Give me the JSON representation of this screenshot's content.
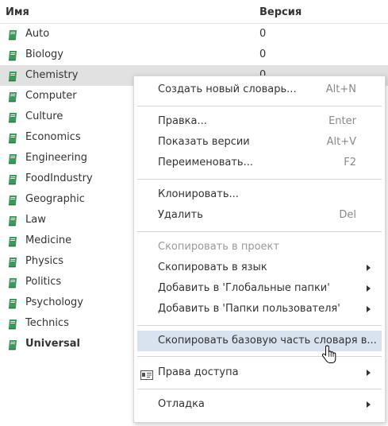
{
  "columns": {
    "name": "Имя",
    "version": "Версия"
  },
  "rows": [
    {
      "name": "Auto",
      "version": "0"
    },
    {
      "name": "Biology",
      "version": "0"
    },
    {
      "name": "Chemistry",
      "version": "0"
    },
    {
      "name": "Computer",
      "version": ""
    },
    {
      "name": "Culture",
      "version": ""
    },
    {
      "name": "Economics",
      "version": ""
    },
    {
      "name": "Engineering",
      "version": ""
    },
    {
      "name": "FoodIndustry",
      "version": ""
    },
    {
      "name": "Geographic",
      "version": ""
    },
    {
      "name": "Law",
      "version": ""
    },
    {
      "name": "Medicine",
      "version": ""
    },
    {
      "name": "Physics",
      "version": ""
    },
    {
      "name": "Politics",
      "version": ""
    },
    {
      "name": "Psychology",
      "version": ""
    },
    {
      "name": "Technics",
      "version": ""
    },
    {
      "name": "Universal",
      "version": ""
    }
  ],
  "menu": {
    "new_dictionary": {
      "label": "Создать новый словарь...",
      "shortcut": "Alt+N"
    },
    "edit": {
      "label": "Правка...",
      "shortcut": "Enter"
    },
    "show_versions": {
      "label": "Показать версии",
      "shortcut": "Alt+V"
    },
    "rename": {
      "label": "Переименовать...",
      "shortcut": "F2"
    },
    "clone": {
      "label": "Клонировать..."
    },
    "delete": {
      "label": "Удалить",
      "shortcut": "Del"
    },
    "copy_to_project": {
      "label": "Скопировать в проект"
    },
    "copy_to_language": {
      "label": "Скопировать в язык"
    },
    "add_global_folders": {
      "label": "Добавить в 'Глобальные папки'"
    },
    "add_user_folders": {
      "label": "Добавить в 'Папки пользователя'"
    },
    "copy_base_part": {
      "label": "Скопировать базовую часть словаря в..."
    },
    "access_rights": {
      "label": "Права доступа"
    },
    "debug": {
      "label": "Отладка"
    }
  },
  "colors": {
    "book_icon": "#3a9a5a",
    "selected_row": "#e1e1e1",
    "menu_highlight": "#d8e3ef"
  },
  "icons": {
    "row_icon": "book-icon",
    "access_icon": "id-card-icon",
    "cursor": "hand-pointer-cursor"
  }
}
